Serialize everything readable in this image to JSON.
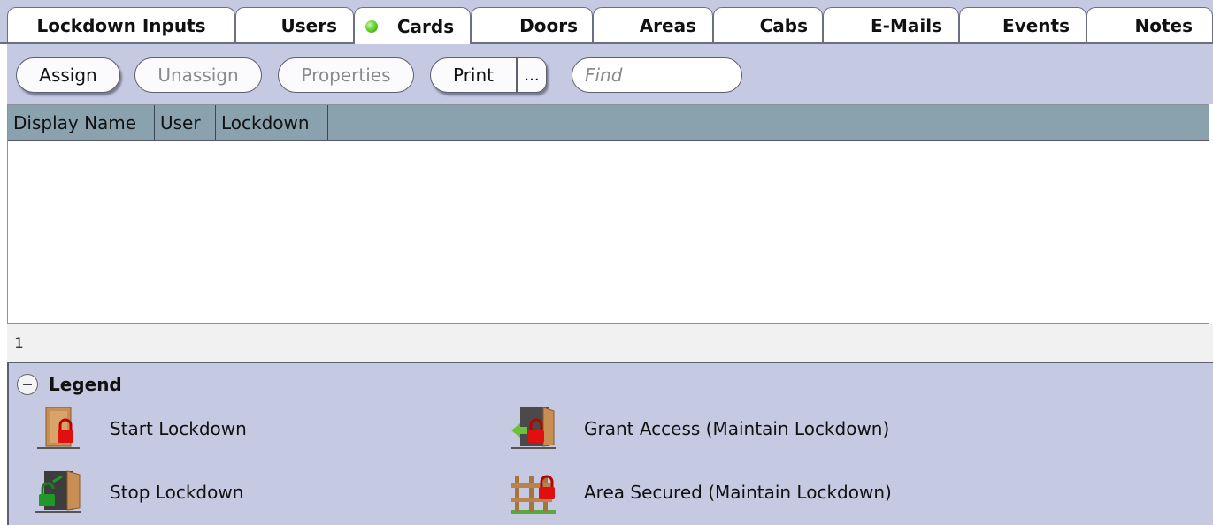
{
  "tabs": [
    {
      "label": "Lockdown Inputs",
      "active": false
    },
    {
      "label": "Users",
      "active": false
    },
    {
      "label": "Cards",
      "active": true
    },
    {
      "label": "Doors",
      "active": false
    },
    {
      "label": "Areas",
      "active": false
    },
    {
      "label": "Cabs",
      "active": false
    },
    {
      "label": "E-Mails",
      "active": false
    },
    {
      "label": "Events",
      "active": false
    },
    {
      "label": "Notes",
      "active": false
    }
  ],
  "toolbar": {
    "assign_label": "Assign",
    "unassign_label": "Unassign",
    "properties_label": "Properties",
    "print_label": "Print",
    "more_label": "...",
    "find_placeholder": "Find",
    "find_value": ""
  },
  "grid": {
    "columns": [
      "Display Name",
      "User",
      "Lockdown"
    ],
    "rows": []
  },
  "status": {
    "count": "1"
  },
  "legend": {
    "title": "Legend",
    "items": [
      {
        "label": "Start Lockdown",
        "icon": "door-lock-icon"
      },
      {
        "label": "Grant Access (Maintain Lockdown)",
        "icon": "grant-access-icon"
      },
      {
        "label": "Stop Lockdown",
        "icon": "door-unlock-icon"
      },
      {
        "label": "Area Secured (Maintain Lockdown)",
        "icon": "area-secured-icon"
      }
    ]
  },
  "colors": {
    "panel": "#c5c9e1",
    "grid_header": "#8aa1ae",
    "lock_red": "#e01010",
    "unlock_green": "#1f9a2a",
    "door_wood": "#c98e54"
  }
}
